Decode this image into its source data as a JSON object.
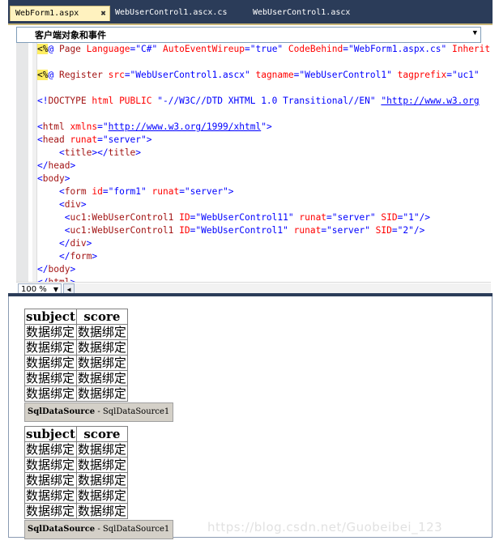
{
  "tabs": [
    {
      "label": "WebForm1.aspx",
      "close": "✖",
      "active": true
    },
    {
      "label": "WebUserControl1.ascx.cs"
    },
    {
      "label": "WebUserControl1.ascx"
    }
  ],
  "editor": {
    "client_objects_dropdown": "客户端对象和事件",
    "zoom": "100 %",
    "lines": [
      [
        {
          "c": "hl",
          "t": "<%"
        },
        {
          "c": "k",
          "t": "@"
        },
        {
          "c": "t",
          "t": " Page "
        },
        {
          "c": "a",
          "t": "Language"
        },
        {
          "c": "k",
          "t": "=\"C#\" "
        },
        {
          "c": "a",
          "t": "AutoEventWireup"
        },
        {
          "c": "k",
          "t": "=\"true\" "
        },
        {
          "c": "a",
          "t": "CodeBehind"
        },
        {
          "c": "k",
          "t": "=\"WebForm1.aspx.cs\" "
        },
        {
          "c": "a",
          "t": "Inherit"
        }
      ],
      [
        {
          "c": "p",
          "t": ""
        }
      ],
      [
        {
          "c": "hl",
          "t": "<%"
        },
        {
          "c": "k",
          "t": "@"
        },
        {
          "c": "t",
          "t": " Register "
        },
        {
          "c": "a",
          "t": "src"
        },
        {
          "c": "k",
          "t": "=\"WebUserControl1.ascx\" "
        },
        {
          "c": "a",
          "t": "tagname"
        },
        {
          "c": "k",
          "t": "=\"WebUserControl1\" "
        },
        {
          "c": "a",
          "t": "tagprefix"
        },
        {
          "c": "k",
          "t": "=\"uc1\""
        }
      ],
      [
        {
          "c": "p",
          "t": ""
        }
      ],
      [
        {
          "c": "k",
          "t": "<!"
        },
        {
          "c": "t",
          "t": "DOCTYPE"
        },
        {
          "c": "a",
          "t": " html"
        },
        {
          "c": "a",
          "t": " PUBLIC"
        },
        {
          "c": "k",
          "t": " \"-//W3C//DTD XHTML 1.0 Transitional//EN\" "
        },
        {
          "c": "u",
          "t": "\"http://www.w3.org"
        }
      ],
      [
        {
          "c": "p",
          "t": ""
        }
      ],
      [
        {
          "c": "k",
          "t": "<"
        },
        {
          "c": "t",
          "t": "html"
        },
        {
          "c": "a",
          "t": " xmlns"
        },
        {
          "c": "k",
          "t": "=\""
        },
        {
          "c": "u",
          "t": "http://www.w3.org/1999/xhtml"
        },
        {
          "c": "k",
          "t": "\">"
        }
      ],
      [
        {
          "c": "k",
          "t": "<"
        },
        {
          "c": "t",
          "t": "head"
        },
        {
          "c": "a",
          "t": " runat"
        },
        {
          "c": "k",
          "t": "=\"server\">"
        }
      ],
      [
        {
          "c": "p",
          "t": "    "
        },
        {
          "c": "k",
          "t": "<"
        },
        {
          "c": "t",
          "t": "title"
        },
        {
          "c": "k",
          "t": "></"
        },
        {
          "c": "t",
          "t": "title"
        },
        {
          "c": "k",
          "t": ">"
        }
      ],
      [
        {
          "c": "k",
          "t": "</"
        },
        {
          "c": "t",
          "t": "head"
        },
        {
          "c": "k",
          "t": ">"
        }
      ],
      [
        {
          "c": "k",
          "t": "<"
        },
        {
          "c": "t",
          "t": "body"
        },
        {
          "c": "k",
          "t": ">"
        }
      ],
      [
        {
          "c": "p",
          "t": "    "
        },
        {
          "c": "k",
          "t": "<"
        },
        {
          "c": "t",
          "t": "form"
        },
        {
          "c": "a",
          "t": " id"
        },
        {
          "c": "k",
          "t": "=\"form1\" "
        },
        {
          "c": "a",
          "t": "runat"
        },
        {
          "c": "k",
          "t": "=\"server\">"
        }
      ],
      [
        {
          "c": "p",
          "t": "    "
        },
        {
          "c": "k",
          "t": "<"
        },
        {
          "c": "t",
          "t": "div"
        },
        {
          "c": "k",
          "t": ">"
        }
      ],
      [
        {
          "c": "p",
          "t": "     "
        },
        {
          "c": "k",
          "t": "<"
        },
        {
          "c": "t",
          "t": "uc1:WebUserControl1"
        },
        {
          "c": "a",
          "t": " ID"
        },
        {
          "c": "k",
          "t": "=\"WebUserControl11\" "
        },
        {
          "c": "a",
          "t": "runat"
        },
        {
          "c": "k",
          "t": "=\"server\" "
        },
        {
          "c": "a",
          "t": "SID"
        },
        {
          "c": "k",
          "t": "=\"1\"/>"
        }
      ],
      [
        {
          "c": "p",
          "t": "     "
        },
        {
          "c": "k",
          "t": "<"
        },
        {
          "c": "t",
          "t": "uc1:WebUserControl1"
        },
        {
          "c": "a",
          "t": " ID"
        },
        {
          "c": "k",
          "t": "=\"WebUserControl1\" "
        },
        {
          "c": "a",
          "t": "runat"
        },
        {
          "c": "k",
          "t": "=\"server\" "
        },
        {
          "c": "a",
          "t": "SID"
        },
        {
          "c": "k",
          "t": "=\"2\"/>"
        }
      ],
      [
        {
          "c": "p",
          "t": "    "
        },
        {
          "c": "k",
          "t": "</"
        },
        {
          "c": "t",
          "t": "div"
        },
        {
          "c": "k",
          "t": ">"
        }
      ],
      [
        {
          "c": "p",
          "t": "    "
        },
        {
          "c": "k",
          "t": "</"
        },
        {
          "c": "t",
          "t": "form"
        },
        {
          "c": "k",
          "t": ">"
        }
      ],
      [
        {
          "c": "k",
          "t": "</"
        },
        {
          "c": "t",
          "t": "body"
        },
        {
          "c": "k",
          "t": ">"
        }
      ],
      [
        {
          "c": "k",
          "t": "</"
        },
        {
          "c": "t",
          "t": "html"
        },
        {
          "c": "k",
          "t": ">"
        }
      ]
    ]
  },
  "design": {
    "controls": [
      {
        "headers": [
          "subject",
          "score"
        ],
        "rows": [
          [
            "数据绑定",
            "数据绑定"
          ],
          [
            "数据绑定",
            "数据绑定"
          ],
          [
            "数据绑定",
            "数据绑定"
          ],
          [
            "数据绑定",
            "数据绑定"
          ],
          [
            "数据绑定",
            "数据绑定"
          ]
        ],
        "datasource_type": "SqlDataSource",
        "datasource_sep": " - ",
        "datasource_id": "SqlDataSource1"
      },
      {
        "headers": [
          "subject",
          "score"
        ],
        "rows": [
          [
            "数据绑定",
            "数据绑定"
          ],
          [
            "数据绑定",
            "数据绑定"
          ],
          [
            "数据绑定",
            "数据绑定"
          ],
          [
            "数据绑定",
            "数据绑定"
          ],
          [
            "数据绑定",
            "数据绑定"
          ]
        ],
        "datasource_type": "SqlDataSource",
        "datasource_sep": " - ",
        "datasource_id": "SqlDataSource1"
      }
    ]
  },
  "watermark": "https://blog.csdn.net/Guobeibei_123"
}
